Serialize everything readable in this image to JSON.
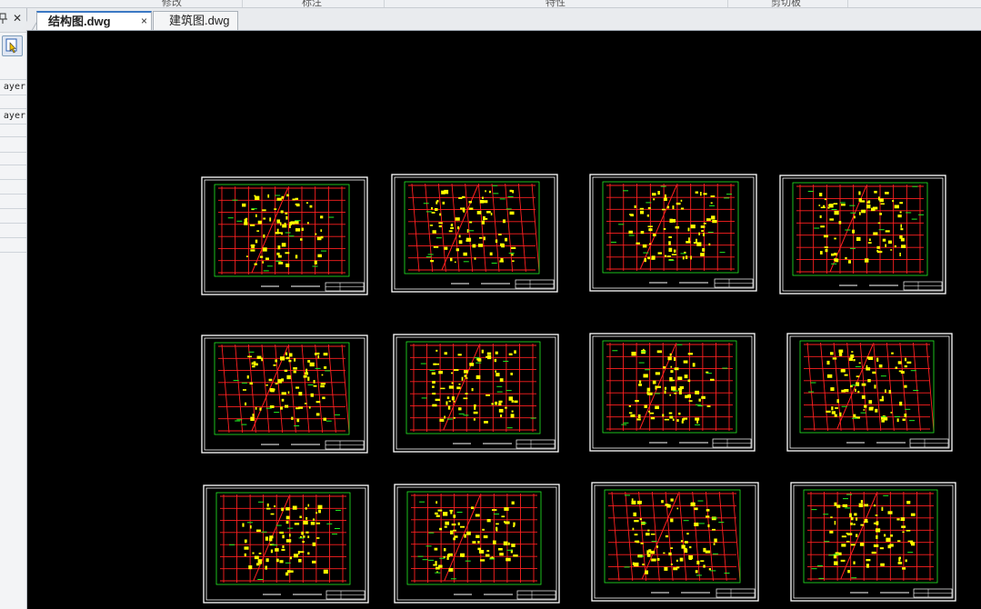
{
  "app": {
    "theme_canvas_color": "#000000"
  },
  "ribbon": {
    "groups": [
      "修改",
      "标注",
      "特性",
      "剪切板"
    ]
  },
  "left_panel": {
    "pin_icon": "pin-icon",
    "close_symbol": "✕",
    "tool_icon": "select-objects-icon",
    "rows": [
      "",
      "ayer",
      "",
      "ayer",
      "",
      "",
      "",
      "",
      "",
      "",
      "",
      "",
      ""
    ]
  },
  "tabs": [
    {
      "label": "结构图.dwg",
      "active": true,
      "close_symbol": "×"
    },
    {
      "label": "建筑图.dwg",
      "active": false
    }
  ],
  "drawing": {
    "sheet_count": 12,
    "colors": {
      "border": "#ffffff",
      "axis": "#ff2020",
      "dimension": "#22ee22",
      "annotation": "#ffff00",
      "title_block": "#ffffff"
    }
  }
}
